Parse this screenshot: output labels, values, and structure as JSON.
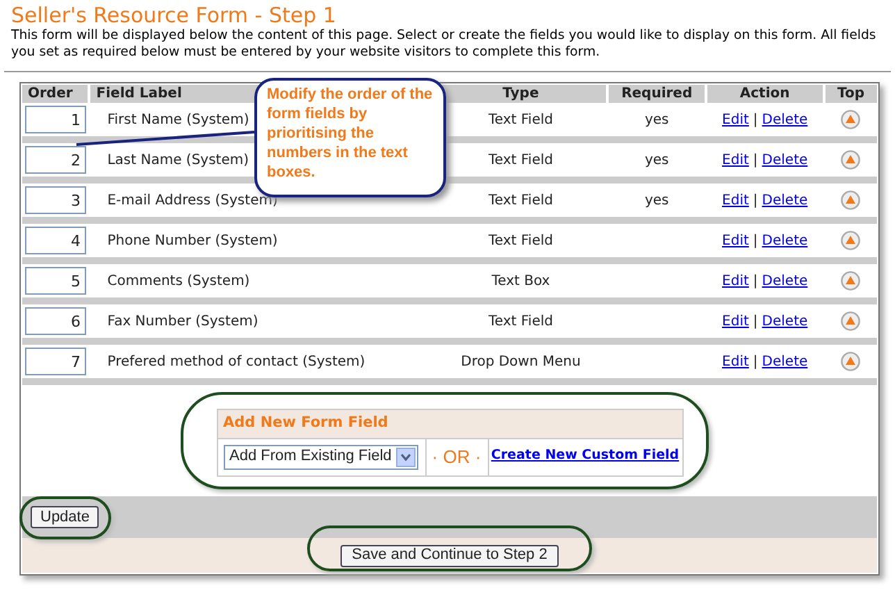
{
  "title": "Seller's Resource Form - Step 1",
  "description": "This form will be displayed below the content of this page. Select or create the fields you would like to display on this form. All fields you set as required below must be entered by your website visitors to complete this form.",
  "table": {
    "columns": [
      "Order",
      "Field Label",
      "Type",
      "Required",
      "Action",
      "Top"
    ],
    "rows": [
      {
        "order": "1",
        "label": "First Name (System)",
        "type": "Text Field",
        "required": "yes",
        "edit": "Edit",
        "separator": "|",
        "delete": "Delete"
      },
      {
        "order": "2",
        "label": "Last Name (System)",
        "type": "Text Field",
        "required": "yes",
        "edit": "Edit",
        "separator": "|",
        "delete": "Delete"
      },
      {
        "order": "3",
        "label": "E-mail Address (System)",
        "type": "Text Field",
        "required": "yes",
        "edit": "Edit",
        "separator": "|",
        "delete": "Delete"
      },
      {
        "order": "4",
        "label": "Phone Number (System)",
        "type": "Text Field",
        "edit": "Edit",
        "separator": "|",
        "delete": "Delete"
      },
      {
        "order": "5",
        "label": "Comments (System)",
        "type": "Text Box",
        "edit": "Edit",
        "separator": "|",
        "delete": "Delete"
      },
      {
        "order": "6",
        "label": "Fax Number (System)",
        "type": "Text Field",
        "edit": "Edit",
        "separator": "|",
        "delete": "Delete"
      },
      {
        "order": "7",
        "label": "Prefered method of contact (System)",
        "type": "Drop Down Menu",
        "edit": "Edit",
        "separator": "|",
        "delete": "Delete"
      }
    ]
  },
  "callout": "Modify the order of the form fields by prioritising the numbers in the text boxes.",
  "add_field": {
    "heading": "Add New Form Field",
    "select_value": "Add From Existing Field",
    "or": "· OR ·",
    "link": "Create New Custom Field"
  },
  "update_button": "Update",
  "save_button": "Save and Continue to Step 2"
}
